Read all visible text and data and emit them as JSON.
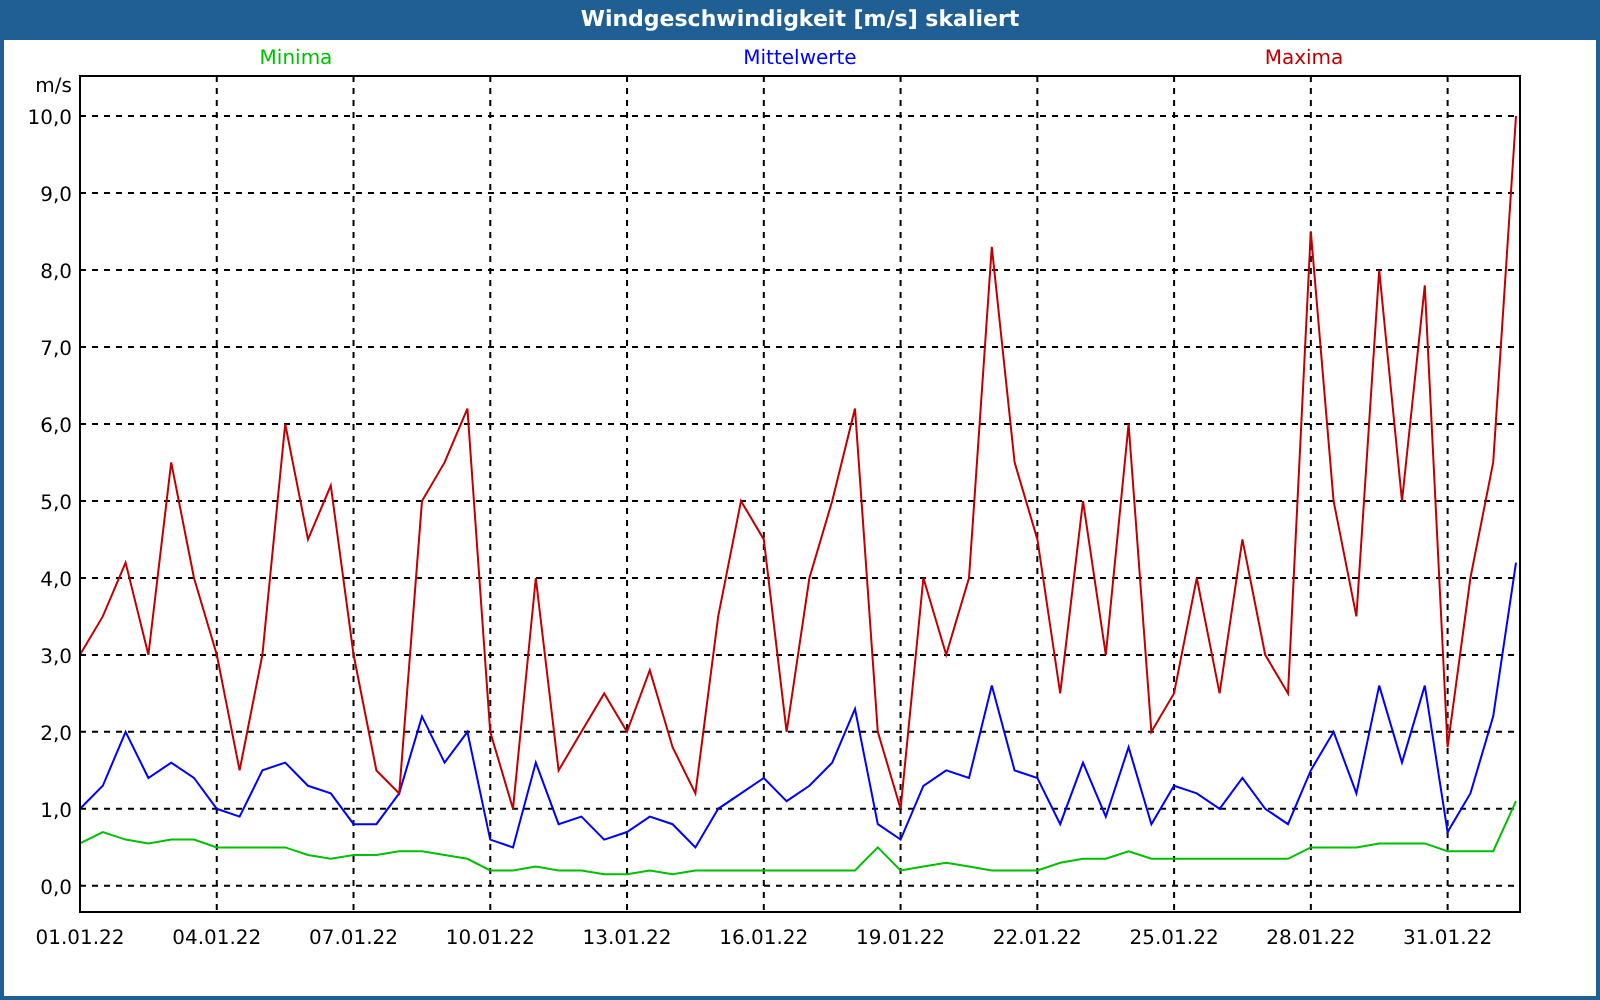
{
  "window": {
    "title": "Windgeschwindigkeit [m/s] skaliert"
  },
  "chart": {
    "chart_data": {
      "type": "line",
      "grid": true,
      "ylabel": "m/s",
      "ylim": [
        -0.34,
        10.52
      ],
      "yticks": [
        {
          "value": 0,
          "label": "0,0"
        },
        {
          "value": 1,
          "label": "1,0"
        },
        {
          "value": 2,
          "label": "2,0"
        },
        {
          "value": 3,
          "label": "3,0"
        },
        {
          "value": 4,
          "label": "4,0"
        },
        {
          "value": 5,
          "label": "5,0"
        },
        {
          "value": 6,
          "label": "6,0"
        },
        {
          "value": 7,
          "label": "7,0"
        },
        {
          "value": 8,
          "label": "8,0"
        },
        {
          "value": 9,
          "label": "9,0"
        },
        {
          "value": 10,
          "label": "10,0"
        }
      ],
      "categories": [
        "01.01.22",
        null,
        null,
        null,
        null,
        null,
        "04.01.22",
        null,
        null,
        null,
        null,
        null,
        "07.01.22",
        null,
        null,
        null,
        null,
        null,
        "10.01.22",
        null,
        null,
        null,
        null,
        null,
        "13.01.22",
        null,
        null,
        null,
        null,
        null,
        "16.01.22",
        null,
        null,
        null,
        null,
        null,
        "19.01.22",
        null,
        null,
        null,
        null,
        null,
        "22.01.22",
        null,
        null,
        null,
        null,
        null,
        "25.01.22",
        null,
        null,
        null,
        null,
        null,
        "28.01.22",
        null,
        null,
        null,
        null,
        null,
        "31.01.22",
        null,
        null,
        null
      ],
      "series": [
        {
          "name": "Minima",
          "color": "#00c000",
          "values": [
            0.55,
            0.7,
            0.6,
            0.55,
            0.6,
            0.6,
            0.5,
            0.5,
            0.5,
            0.5,
            0.4,
            0.35,
            0.4,
            0.4,
            0.45,
            0.45,
            0.4,
            0.35,
            0.2,
            0.2,
            0.25,
            0.2,
            0.2,
            0.15,
            0.15,
            0.2,
            0.15,
            0.2,
            0.2,
            0.2,
            0.2,
            0.2,
            0.2,
            0.2,
            0.2,
            0.5,
            0.2,
            0.25,
            0.3,
            0.25,
            0.2,
            0.2,
            0.2,
            0.3,
            0.35,
            0.35,
            0.45,
            0.35,
            0.35,
            0.35,
            0.35,
            0.35,
            0.35,
            0.35,
            0.5,
            0.5,
            0.5,
            0.55,
            0.55,
            0.55,
            0.45,
            0.45,
            0.45,
            1.1
          ]
        },
        {
          "name": "Mittelwerte",
          "color": "#0000ff",
          "values": [
            1.0,
            1.3,
            2.0,
            1.4,
            1.6,
            1.4,
            1.0,
            0.9,
            1.5,
            1.6,
            1.3,
            1.2,
            0.8,
            0.8,
            1.2,
            2.2,
            1.6,
            2.0,
            0.6,
            0.5,
            1.6,
            0.8,
            0.9,
            0.6,
            0.7,
            0.9,
            0.8,
            0.5,
            1.0,
            1.2,
            1.4,
            1.1,
            1.3,
            1.6,
            2.3,
            0.8,
            0.6,
            1.3,
            1.5,
            1.4,
            2.6,
            1.5,
            1.4,
            0.8,
            1.6,
            0.9,
            1.8,
            0.8,
            1.3,
            1.2,
            1.0,
            1.4,
            1.0,
            0.8,
            1.5,
            2.0,
            1.2,
            2.6,
            1.6,
            2.6,
            0.7,
            1.2,
            2.2,
            4.2
          ]
        },
        {
          "name": "Maxima",
          "color": "#c00000",
          "values": [
            3.0,
            3.5,
            4.2,
            3.0,
            5.5,
            4.0,
            3.0,
            1.5,
            3.0,
            6.0,
            4.5,
            5.2,
            3.0,
            1.5,
            1.2,
            5.0,
            5.5,
            6.2,
            2.0,
            1.0,
            4.0,
            1.5,
            2.0,
            2.5,
            2.0,
            2.8,
            1.8,
            1.2,
            3.5,
            5.0,
            4.5,
            2.0,
            4.0,
            5.0,
            6.2,
            2.0,
            1.0,
            4.0,
            3.0,
            4.0,
            8.3,
            5.5,
            4.5,
            2.5,
            5.0,
            3.0,
            6.0,
            2.0,
            2.5,
            4.0,
            2.5,
            4.5,
            3.0,
            2.5,
            8.5,
            5.0,
            3.5,
            8.0,
            5.0,
            7.8,
            1.8,
            4.0,
            5.5,
            10.0
          ]
        }
      ]
    }
  }
}
